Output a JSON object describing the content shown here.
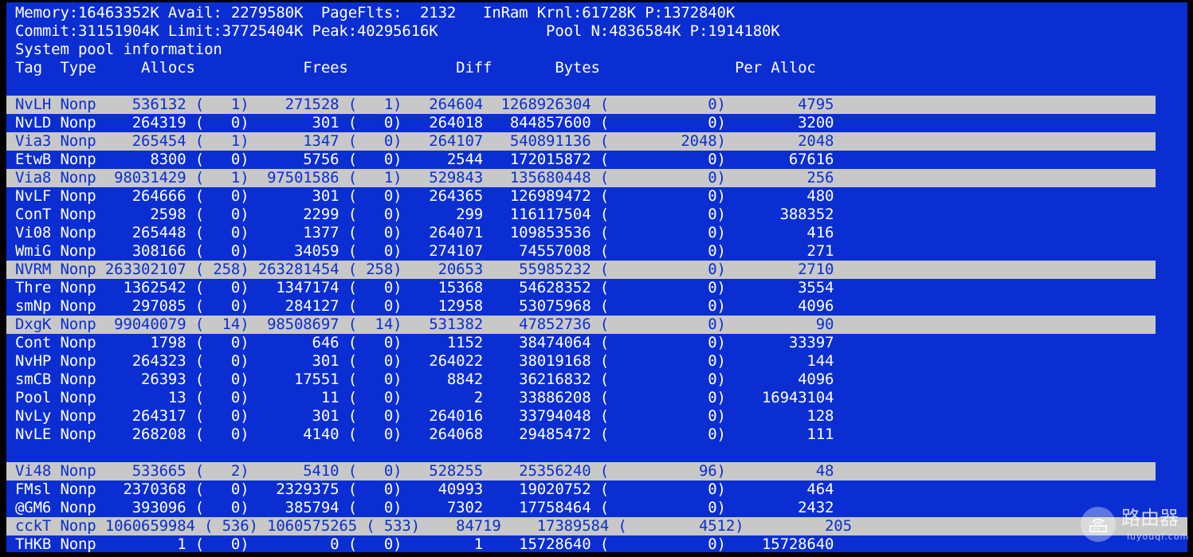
{
  "header": {
    "line1": "Memory:16463352K Avail: 2279580K  PageFlts:  2132   InRam Krnl:61728K P:1372840K",
    "line2": "Commit:31151904K Limit:37725404K Peak:40295616K            Pool N:4836584K P:1914180K",
    "line3": "System pool information",
    "line4": "Tag  Type     Allocs            Frees            Diff       Bytes               Per Alloc"
  },
  "rows": [
    {
      "text": "NvLH Nonp    536132 (   1)    271528 (   1)   264604  1268926304 (           0)        4795",
      "highlighted": true
    },
    {
      "text": "NvLD Nonp    264319 (   0)       301 (   0)   264018   844857600 (           0)        3200",
      "highlighted": false
    },
    {
      "text": "Via3 Nonp    265454 (   1)      1347 (   0)   264107   540891136 (        2048)        2048",
      "highlighted": true
    },
    {
      "text": "EtwB Nonp      8300 (   0)      5756 (   0)     2544   172015872 (           0)       67616",
      "highlighted": false
    },
    {
      "text": "Via8 Nonp  98031429 (   1)  97501586 (   1)   529843   135680448 (           0)         256",
      "highlighted": true
    },
    {
      "text": "NvLF Nonp    264666 (   0)       301 (   0)   264365   126989472 (           0)         480",
      "highlighted": false
    },
    {
      "text": "ConT Nonp      2598 (   0)      2299 (   0)      299   116117504 (           0)      388352",
      "highlighted": false
    },
    {
      "text": "Vi08 Nonp    265448 (   0)      1377 (   0)   264071   109853536 (           0)         416",
      "highlighted": false
    },
    {
      "text": "WmiG Nonp    308166 (   0)     34059 (   0)   274107    74557008 (           0)         271",
      "highlighted": false
    },
    {
      "text": "NVRM Nonp 263302107 ( 258) 263281454 ( 258)    20653    55985232 (           0)        2710",
      "highlighted": true
    },
    {
      "text": "Thre Nonp   1362542 (   0)   1347174 (   0)    15368    54628352 (           0)        3554",
      "highlighted": false
    },
    {
      "text": "smNp Nonp    297085 (   0)    284127 (   0)    12958    53075968 (           0)        4096",
      "highlighted": false
    },
    {
      "text": "DxgK Nonp  99040079 (  14)  98508697 (  14)   531382    47852736 (           0)          90",
      "highlighted": true
    },
    {
      "text": "Cont Nonp      1798 (   0)       646 (   0)     1152    38474064 (           0)       33397",
      "highlighted": false
    },
    {
      "text": "NvHP Nonp    264323 (   0)       301 (   0)   264022    38019168 (           0)         144",
      "highlighted": false
    },
    {
      "text": "smCB Nonp     26393 (   0)     17551 (   0)     8842    36216832 (           0)        4096",
      "highlighted": false
    },
    {
      "text": "Pool Nonp        13 (   0)        11 (   0)        2    33886208 (           0)    16943104",
      "highlighted": false
    },
    {
      "text": "NvLy Nonp    264317 (   0)       301 (   0)   264016    33794048 (           0)         128",
      "highlighted": false
    },
    {
      "text": "NvLE Nonp    268208 (   0)      4140 (   0)   264068    29485472 (           0)         111",
      "highlighted": false
    },
    {
      "text": "",
      "highlighted": false
    },
    {
      "text": "Vi48 Nonp    533665 (   2)      5410 (   0)   528255    25356240 (          96)          48",
      "highlighted": true
    },
    {
      "text": "FMsl Nonp   2370368 (   0)   2329375 (   0)    40993    19020752 (           0)         464",
      "highlighted": false
    },
    {
      "text": "@GM6 Nonp    393096 (   0)    385794 (   0)     7302    17758464 (           0)        2432",
      "highlighted": false
    },
    {
      "text": "cckT Nonp 1060659984 ( 536) 1060575265 ( 533)    84719    17389584 (        4512)         205",
      "highlighted": true,
      "wide": true
    },
    {
      "text": "THKB Nonp         1 (   0)         0 (   0)        1    15728640 (           0)    15728640",
      "highlighted": false
    }
  ],
  "watermark": {
    "cn": "路由器",
    "en": "luyouqi.com"
  }
}
